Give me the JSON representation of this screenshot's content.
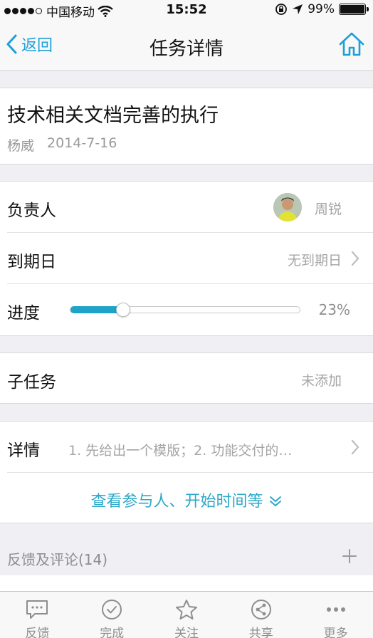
{
  "status": {
    "carrier": "中国移动",
    "time": "15:52",
    "battery": "99%",
    "battery_level": 0.99
  },
  "nav": {
    "back_label": "返回",
    "title": "任务详情"
  },
  "task": {
    "title": "技术相关文档完善的执行",
    "author": "杨威",
    "date": "2014-7-16"
  },
  "owner": {
    "label": "负责人",
    "name": "周锐"
  },
  "due": {
    "label": "到期日",
    "value": "无到期日"
  },
  "progress": {
    "label": "进度",
    "text": "23%",
    "fraction": 0.23
  },
  "subtask": {
    "label": "子任务",
    "value": "未添加"
  },
  "detail": {
    "label": "详情",
    "text": "1. 先给出一个模版；2. 功能交付的…",
    "more": "查看参与人、开始时间等"
  },
  "comments": {
    "title": "反馈及评论(14)"
  },
  "tabs": [
    {
      "label": "反馈",
      "icon": "chat-icon"
    },
    {
      "label": "完成",
      "icon": "check-circle-icon"
    },
    {
      "label": "关注",
      "icon": "star-icon"
    },
    {
      "label": "共享",
      "icon": "share-icon"
    },
    {
      "label": "更多",
      "icon": "more-icon"
    }
  ],
  "colors": {
    "accent": "#1f9fd9",
    "progress": "#1fa3c9",
    "link": "#2ea8c8"
  }
}
